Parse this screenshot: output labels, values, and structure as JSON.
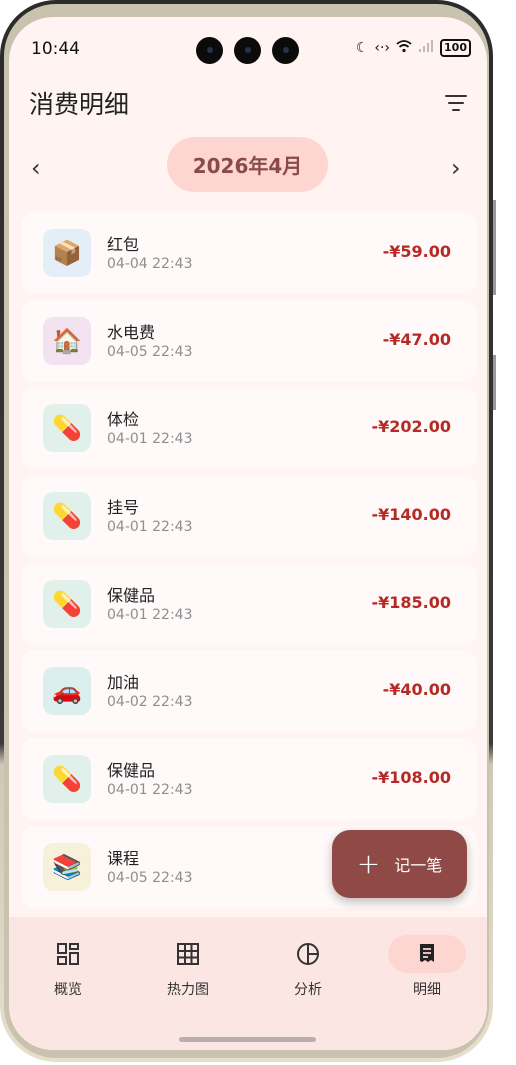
{
  "status_bar": {
    "time": "10:44",
    "battery": "100"
  },
  "header": {
    "title": "消费明细"
  },
  "month_nav": {
    "label": "2026年4月",
    "prev": "‹",
    "next": "›"
  },
  "transactions": [
    {
      "icon": "📦",
      "icon_name": "package-icon",
      "icon_bg": "#e3eef7",
      "name": "红包",
      "time": "04-04 22:43",
      "amount": "-¥59.00"
    },
    {
      "icon": "🏠",
      "icon_name": "house-icon",
      "icon_bg": "#f3e3f0",
      "name": "水电费",
      "time": "04-05 22:43",
      "amount": "-¥47.00"
    },
    {
      "icon": "💊",
      "icon_name": "pill-icon",
      "icon_bg": "#e2f0ec",
      "name": "体检",
      "time": "04-01 22:43",
      "amount": "-¥202.00"
    },
    {
      "icon": "💊",
      "icon_name": "pill-icon",
      "icon_bg": "#e2f0ec",
      "name": "挂号",
      "time": "04-01 22:43",
      "amount": "-¥140.00"
    },
    {
      "icon": "💊",
      "icon_name": "pill-icon",
      "icon_bg": "#e2f0ec",
      "name": "保健品",
      "time": "04-01 22:43",
      "amount": "-¥185.00"
    },
    {
      "icon": "🚗",
      "icon_name": "car-icon",
      "icon_bg": "#dcefef",
      "name": "加油",
      "time": "04-02 22:43",
      "amount": "-¥40.00"
    },
    {
      "icon": "💊",
      "icon_name": "pill-icon",
      "icon_bg": "#e2f0ec",
      "name": "保健品",
      "time": "04-01 22:43",
      "amount": "-¥108.00"
    },
    {
      "icon": "📚",
      "icon_name": "books-icon",
      "icon_bg": "#f7f1dc",
      "name": "课程",
      "time": "04-05 22:43",
      "amount": ""
    }
  ],
  "fab": {
    "label": "记一笔"
  },
  "bottom_nav": [
    {
      "label": "概览",
      "icon_name": "grid-icon",
      "active": false
    },
    {
      "label": "热力图",
      "icon_name": "calendar-grid-icon",
      "active": false
    },
    {
      "label": "分析",
      "icon_name": "pie-chart-icon",
      "active": false
    },
    {
      "label": "明细",
      "icon_name": "receipt-icon",
      "active": true
    }
  ],
  "colors": {
    "accent": "#8f4a47",
    "amount": "#b52a25",
    "pill": "#fdd6d2",
    "background": "#fff4f1"
  }
}
